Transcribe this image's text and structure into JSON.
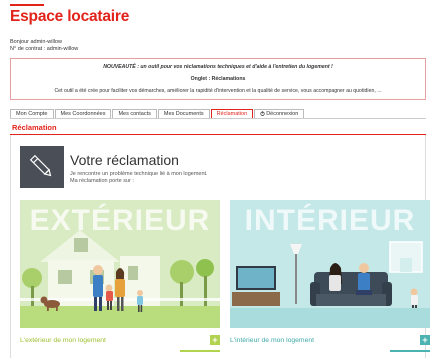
{
  "header": {
    "title": "Espace locataire",
    "greeting_line1": "Bonjour admin-willow",
    "greeting_line2": "N° de contrat : admin-willow"
  },
  "notice": {
    "line1": "NOUVEAUTÉ : un outil pour vos réclamations techniques et d'aide à l'entretien du logement !",
    "line2": "Onglet : Réclamations",
    "line3": "Cet outil a été crée pour faciliter vos démarches, améliorer la rapidité d'intervention et la qualité de service, vous accompagner au quotidien, ..."
  },
  "tabs": [
    {
      "label": "Mon Compte"
    },
    {
      "label": "Mes Coordonnées"
    },
    {
      "label": "Mes contacts"
    },
    {
      "label": "Mes Documents"
    },
    {
      "label": "Réclamation"
    },
    {
      "label": "Déconnexion"
    }
  ],
  "section": {
    "title": "Réclamation"
  },
  "intro": {
    "title": "Votre réclamation",
    "text1": "Je rencontre un problème technique lié à mon logement.",
    "text2": "Ma réclamation porte sur :"
  },
  "cards": {
    "exterior": {
      "word": "EXTÉRIEUR",
      "label": "L'extérieur de mon logement",
      "plus": "+"
    },
    "interior": {
      "word": "INTÉRIEUR",
      "label": "L'intérieur de mon logement",
      "plus": "+"
    }
  },
  "colors": {
    "brand_red": "#e2231a",
    "exterior_green": "#b2d34f",
    "interior_teal": "#4bb4b2"
  }
}
